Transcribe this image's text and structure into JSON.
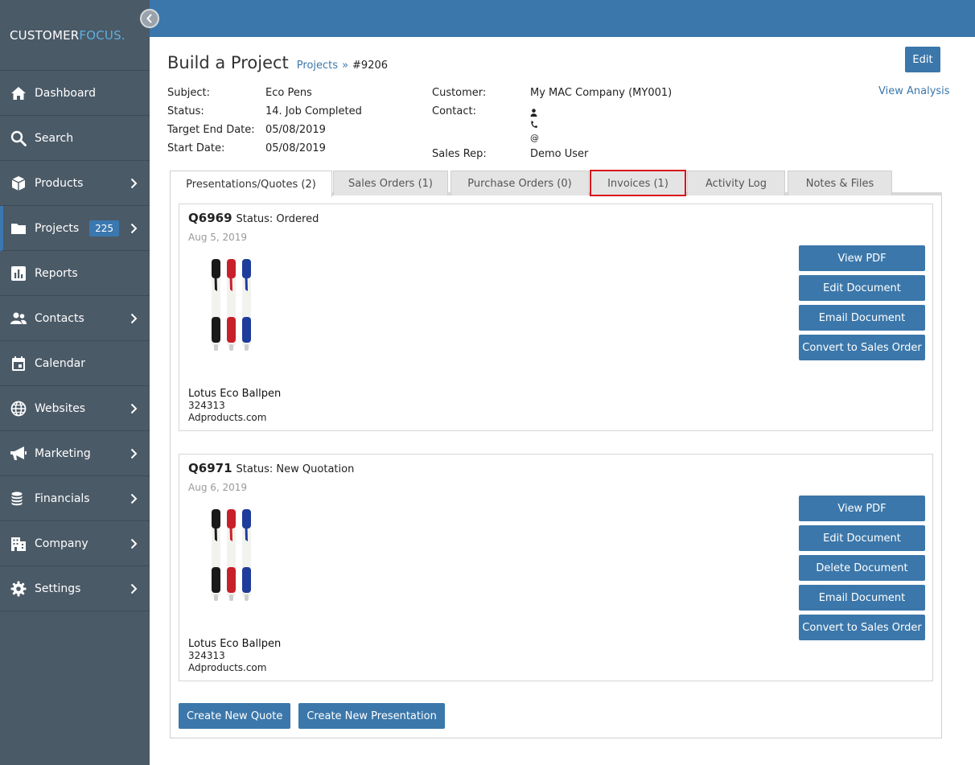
{
  "brand": {
    "part1": "CUSTOMER",
    "part2": "FOCUS."
  },
  "sidebar": {
    "items": [
      {
        "label": "Dashboard",
        "icon": "home-icon",
        "chevron": false
      },
      {
        "label": "Search",
        "icon": "search-icon",
        "chevron": false
      },
      {
        "label": "Products",
        "icon": "box-icon",
        "chevron": true
      },
      {
        "label": "Projects",
        "icon": "folder-icon",
        "chevron": true,
        "badge": "225",
        "active": true
      },
      {
        "label": "Reports",
        "icon": "bar-chart-icon",
        "chevron": false
      },
      {
        "label": "Contacts",
        "icon": "users-icon",
        "chevron": true
      },
      {
        "label": "Calendar",
        "icon": "calendar-icon",
        "chevron": false
      },
      {
        "label": "Websites",
        "icon": "globe-icon",
        "chevron": true
      },
      {
        "label": "Marketing",
        "icon": "megaphone-icon",
        "chevron": true
      },
      {
        "label": "Financials",
        "icon": "coins-icon",
        "chevron": true
      },
      {
        "label": "Company",
        "icon": "building-icon",
        "chevron": true
      },
      {
        "label": "Settings",
        "icon": "gear-icon",
        "chevron": true
      }
    ]
  },
  "header": {
    "title": "Build a Project",
    "breadcrumb": {
      "link": "Projects",
      "sep": "»",
      "current": "#9206"
    },
    "edit_label": "Edit",
    "view_analysis": "View Analysis"
  },
  "info": {
    "subject_label": "Subject:",
    "subject": "Eco Pens",
    "status_label": "Status:",
    "status": "14. Job Completed",
    "target_end_label": "Target End Date:",
    "target_end": "05/08/2019",
    "start_label": "Start Date:",
    "start": "05/08/2019",
    "customer_label": "Customer:",
    "customer": "My MAC Company (MY001)",
    "contact_label": "Contact:",
    "contact_email_symbol": "@",
    "sales_rep_label": "Sales Rep:",
    "sales_rep": "Demo User"
  },
  "tabs": [
    "Presentations/Quotes (2)",
    "Sales Orders (1)",
    "Purchase Orders (0)",
    "Invoices (1)",
    "Activity Log",
    "Notes & Files"
  ],
  "documents": [
    {
      "id": "Q6969",
      "status": "Status: Ordered",
      "date": "Aug 5, 2019",
      "product_name": "Lotus Eco Ballpen",
      "product_code": "324313",
      "supplier": "Adproducts.com",
      "actions": [
        "View PDF",
        "Edit Document",
        "Email Document",
        "Convert to Sales Order"
      ]
    },
    {
      "id": "Q6971",
      "status": "Status: New Quotation",
      "date": "Aug 6, 2019",
      "product_name": "Lotus Eco Ballpen",
      "product_code": "324313",
      "supplier": "Adproducts.com",
      "actions": [
        "View PDF",
        "Edit Document",
        "Delete Document",
        "Email Document",
        "Convert to Sales Order"
      ]
    }
  ],
  "footer": {
    "create_quote": "Create New Quote",
    "create_presentation": "Create New Presentation"
  },
  "colors": {
    "accent": "#3b77aa",
    "sidebar": "#4b5a67",
    "highlight": "#d9141c"
  }
}
